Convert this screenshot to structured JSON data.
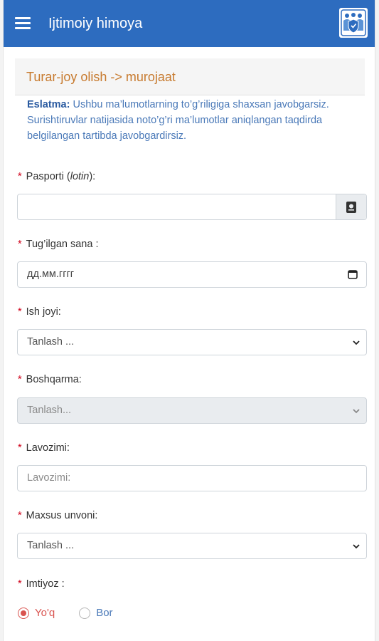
{
  "header": {
    "title": "Ijtimoiy himoya"
  },
  "panel": {
    "title": "Turar-joy olish -> murojaat"
  },
  "note": {
    "bold": "Eslatma:",
    "text": " Ushbu ma’lumotlarning to’g’riligiga shaxsan javobgarsiz. Surishtiruvlar natijasida noto’g’ri ma’lumotlar aniqlangan taqdirda belgilangan tartibda javobgardirsiz."
  },
  "fields": {
    "passport": {
      "label_a": "Pasporti (",
      "label_i": "lotin",
      "label_b": "):",
      "value": ""
    },
    "birth": {
      "label": "Tug’ilgan sana :",
      "placeholder": "дд.мм.гггг"
    },
    "work": {
      "label": "Ish joyi:",
      "selected": "Tanlash ..."
    },
    "department": {
      "label": "Boshqarma:",
      "selected": "Tanlash..."
    },
    "position": {
      "label": "Lavozimi:",
      "placeholder": "Lavozimi:"
    },
    "rank": {
      "label": "Maxsus unvoni:",
      "selected": "Tanlash ..."
    },
    "privilege": {
      "label": "Imtiyoz :",
      "options": [
        "Yo'q",
        "Bor"
      ],
      "selected": "Yo'q"
    }
  },
  "colors": {
    "appbar": "#2d6cbf",
    "panel_title": "#c77a2e",
    "required": "#d0021b",
    "note": "#4a79b8"
  },
  "icons": {
    "menu": "hamburger-icon",
    "logo": "app-logo-icon",
    "passport_lookup": "passport-icon",
    "calendar": "calendar-icon",
    "select": "chevron-down-icon"
  }
}
